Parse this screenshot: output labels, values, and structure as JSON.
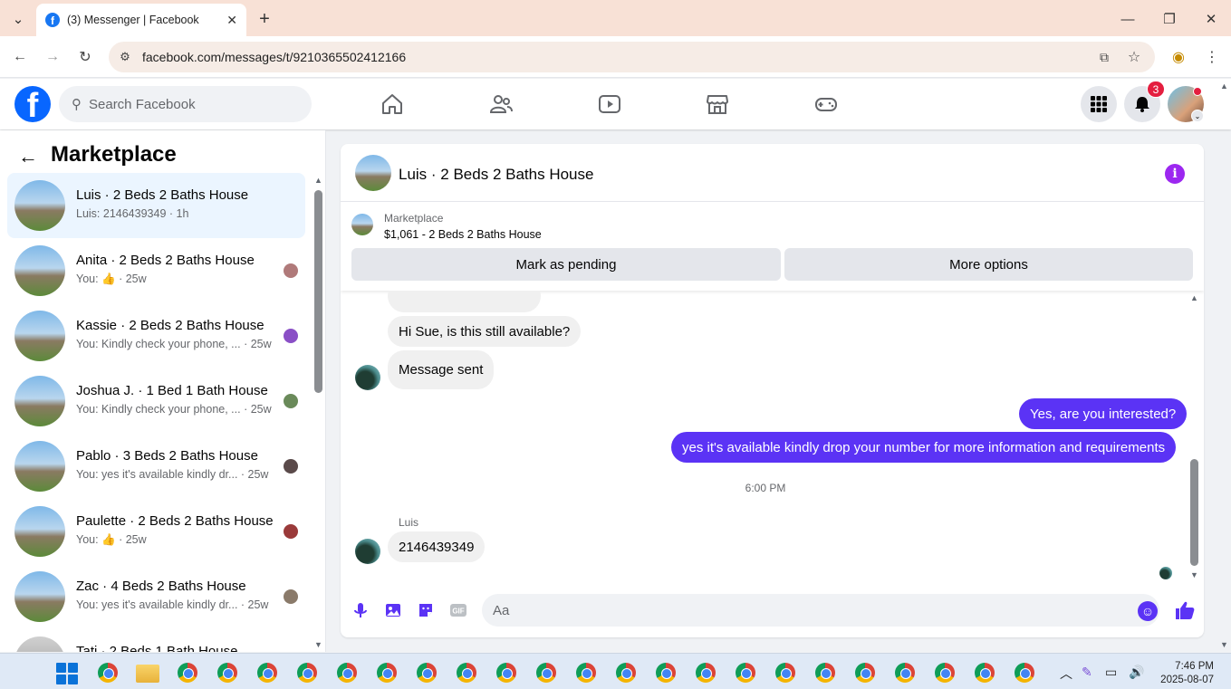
{
  "browser": {
    "tab_title": "(3) Messenger | Facebook",
    "url": "facebook.com/messages/t/9210365502412166",
    "new_tab_label": "+"
  },
  "fb_header": {
    "logo_letter": "f",
    "search_placeholder": "Search Facebook",
    "notification_count": "3",
    "accent_color": "#0866ff"
  },
  "left_panel": {
    "title": "Marketplace",
    "conversations": [
      {
        "name": "Luis · 2 Beds 2 Baths House",
        "preview": "Luis: 2146439349 · 1h",
        "active": true
      },
      {
        "name": "Anita · 2 Beds 2 Baths House",
        "preview": "You: 👍 · 25w"
      },
      {
        "name": "Kassie · 2 Beds 2 Baths House",
        "preview": "You: Kindly check your phone, ... · 25w"
      },
      {
        "name": "Joshua J. · 1 Bed 1 Bath House",
        "preview": "You: Kindly check your phone, ... · 25w"
      },
      {
        "name": "Pablo · 3 Beds 2 Baths House",
        "preview": "You: yes it's available kindly dr... · 25w"
      },
      {
        "name": "Paulette · 2 Beds 2 Baths House",
        "preview": "You: 👍 · 25w"
      },
      {
        "name": "Zac · 4 Beds 2 Baths House",
        "preview": "You: yes it's available kindly dr... · 25w"
      },
      {
        "name": "Tati · 2 Beds 1 Bath House",
        "preview": ""
      }
    ]
  },
  "chat": {
    "title": "Luis · 2 Beds 2 Baths House",
    "listing_category": "Marketplace",
    "listing_price": "$1,061 - 2 Beds 2 Baths House",
    "mark_pending_label": "Mark as pending",
    "more_options_label": "More options",
    "messages": {
      "m1": "Hi Sue, is this still available?",
      "m2": "Message sent",
      "m3": "Yes, are you interested?",
      "m4": "yes it's available kindly drop your number for more information and requirements",
      "timestamp": "6:00 PM",
      "sender": "Luis",
      "m5": "2146439349"
    },
    "composer_placeholder": "Aa",
    "accent_color": "#5b33f5",
    "icons": [
      "mic-icon",
      "photo-icon",
      "sticker-icon",
      "gif-icon",
      "emoji-icon",
      "like-icon"
    ]
  },
  "taskbar": {
    "time": "7:46 PM",
    "date": "2025-08-07"
  }
}
